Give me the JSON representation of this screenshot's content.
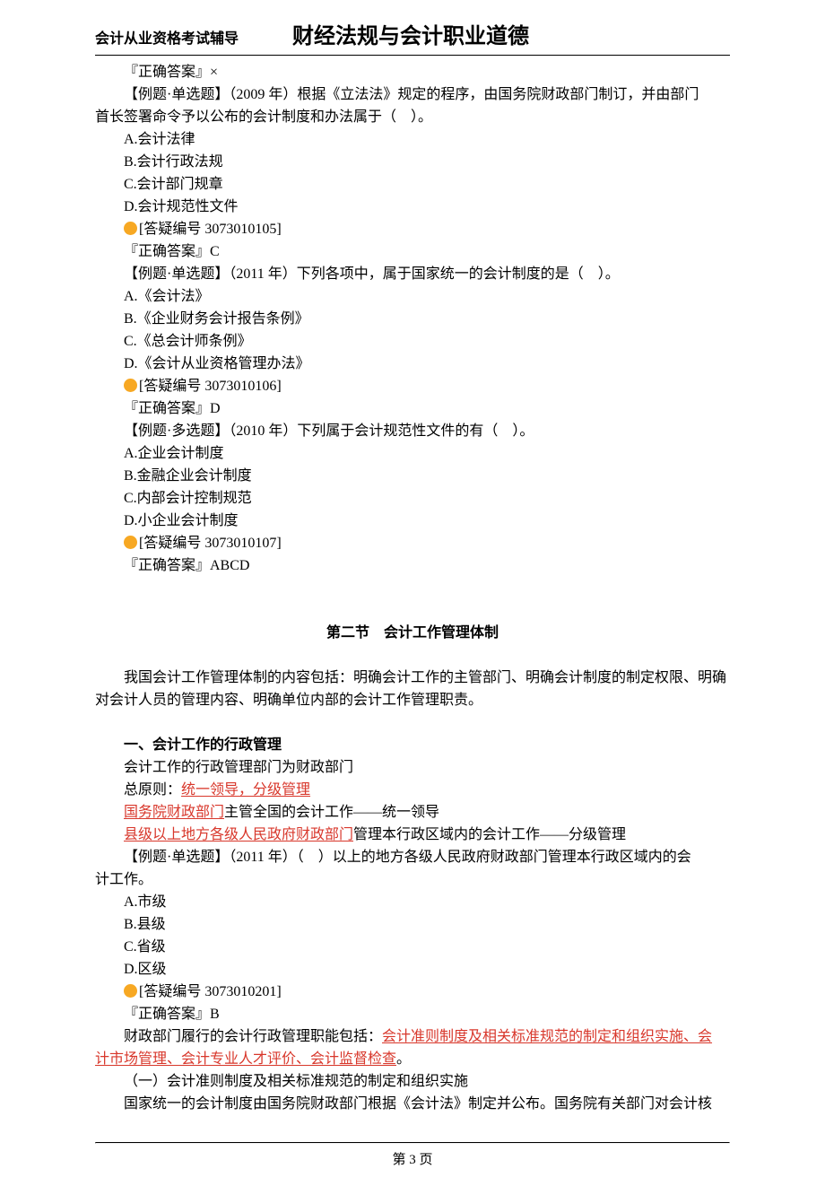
{
  "header": {
    "left": "会计从业资格考试辅导",
    "title": "财经法规与会计职业道德"
  },
  "blocks": [
    {
      "type": "ans",
      "text": "『正确答案』×"
    },
    {
      "type": "p",
      "text": "【例题·单选题】（2009 年）根据《立法法》规定的程序，由国务院财政部门制订，并由部门首长签署命令予以公布的会计制度和办法属于（　）。",
      "indentContinuation": "首长签署命令予以公布的会计制度和办法属于（　）。",
      "first": "【例题·单选题】（2009 年）根据《立法法》规定的程序，由国务院财政部门制订，并由部门"
    },
    {
      "type": "opt",
      "text": "A.会计法律"
    },
    {
      "type": "opt",
      "text": "B.会计行政法规"
    },
    {
      "type": "opt",
      "text": "C.会计部门规章"
    },
    {
      "type": "opt",
      "text": "D.会计规范性文件"
    },
    {
      "type": "qid",
      "text": "[答疑编号 3073010105]"
    },
    {
      "type": "ans",
      "text": "『正确答案』C"
    },
    {
      "type": "p1",
      "text": "【例题·单选题】（2011 年）下列各项中，属于国家统一的会计制度的是（　）。"
    },
    {
      "type": "opt",
      "text": "A.《会计法》"
    },
    {
      "type": "opt",
      "text": "B.《企业财务会计报告条例》"
    },
    {
      "type": "opt",
      "text": "C.《总会计师条例》"
    },
    {
      "type": "opt",
      "text": "D.《会计从业资格管理办法》"
    },
    {
      "type": "qid",
      "text": "[答疑编号 3073010106]"
    },
    {
      "type": "ans",
      "text": "『正确答案』D"
    },
    {
      "type": "p1",
      "text": "【例题·多选题】（2010 年）下列属于会计规范性文件的有（　）。"
    },
    {
      "type": "opt",
      "text": "A.企业会计制度"
    },
    {
      "type": "opt",
      "text": "B.金融企业会计制度"
    },
    {
      "type": "opt",
      "text": "C.内部会计控制规范"
    },
    {
      "type": "opt",
      "text": "D.小企业会计制度"
    },
    {
      "type": "qid",
      "text": "[答疑编号 3073010107]"
    },
    {
      "type": "ans",
      "text": "『正确答案』ABCD"
    }
  ],
  "section2": {
    "title": "第二节　会计工作管理体制",
    "intro": "我国会计工作管理体制的内容包括：明确会计工作的主管部门、明确会计制度的制定权限、明确对会计人员的管理内容、明确单位内部的会计工作管理职责。",
    "heading1": "一、会计工作的行政管理",
    "line1": "会计工作的行政管理部门为财政部门",
    "line2_pre": "总原则：",
    "line2_red": "统一领导，分级管理",
    "line3_red": "国务院财政部门",
    "line3_post": "主管全国的会计工作——统一领导",
    "line4_red": "县级以上地方各级人民政府财政部门",
    "line4_post": "管理本行政区域内的会计工作——分级管理",
    "q_line1": "【例题·单选题】（2011 年）（　）以上的地方各级人民政府财政部门管理本行政区域内的会",
    "q_line2": "计工作。",
    "opts": [
      "A.市级",
      "B.县级",
      "C.省级",
      "D.区级"
    ],
    "qid": "[答疑编号 3073010201]",
    "ans": "『正确答案』B",
    "para2_pre": "财政部门履行的会计行政管理职能包括：",
    "para2_red1": "会计准则制度及相关标准规范的制定和组织实施、会",
    "para2_red2": "计市场管理、会计专业人才评价、会计监督检查",
    "para2_post": "。",
    "sub1": "（一）会计准则制度及相关标准规范的制定和组织实施",
    "sub1_text": "国家统一的会计制度由国务院财政部门根据《会计法》制定并公布。国务院有关部门对会计核"
  },
  "footer": {
    "page": "第 3 页"
  }
}
